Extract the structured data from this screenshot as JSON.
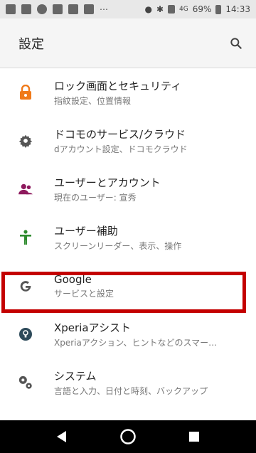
{
  "status": {
    "battery_percent": "69%",
    "time": "14:33",
    "network": "4G"
  },
  "appbar": {
    "title": "設定"
  },
  "items": [
    {
      "title": "ロック画面とセキュリティ",
      "subtitle": "指紋設定、位置情報",
      "icon": "lock-icon",
      "color": "#f07a1a"
    },
    {
      "title": "ドコモのサービス/クラウド",
      "subtitle": "dアカウント設定、ドコモクラウド",
      "icon": "gear-icon",
      "color": "#555555"
    },
    {
      "title": "ユーザーとアカウント",
      "subtitle": "現在のユーザー: 宣秀",
      "icon": "users-icon",
      "color": "#8e1a5e"
    },
    {
      "title": "ユーザー補助",
      "subtitle": "スクリーンリーダー、表示、操作",
      "icon": "accessibility-icon",
      "color": "#2e8b2e"
    },
    {
      "title": "Google",
      "subtitle": "サービスと設定",
      "icon": "google-g-icon",
      "color": "#555555"
    },
    {
      "title": "Xperiaアシスト",
      "subtitle": "Xperiaアクション、ヒントなどのスマー…",
      "icon": "xperia-assist-icon",
      "color": "#2d4a5a"
    },
    {
      "title": "システム",
      "subtitle": "言語と入力、日付と時刻、バックアップ",
      "icon": "system-gears-icon",
      "color": "#555555"
    }
  ]
}
